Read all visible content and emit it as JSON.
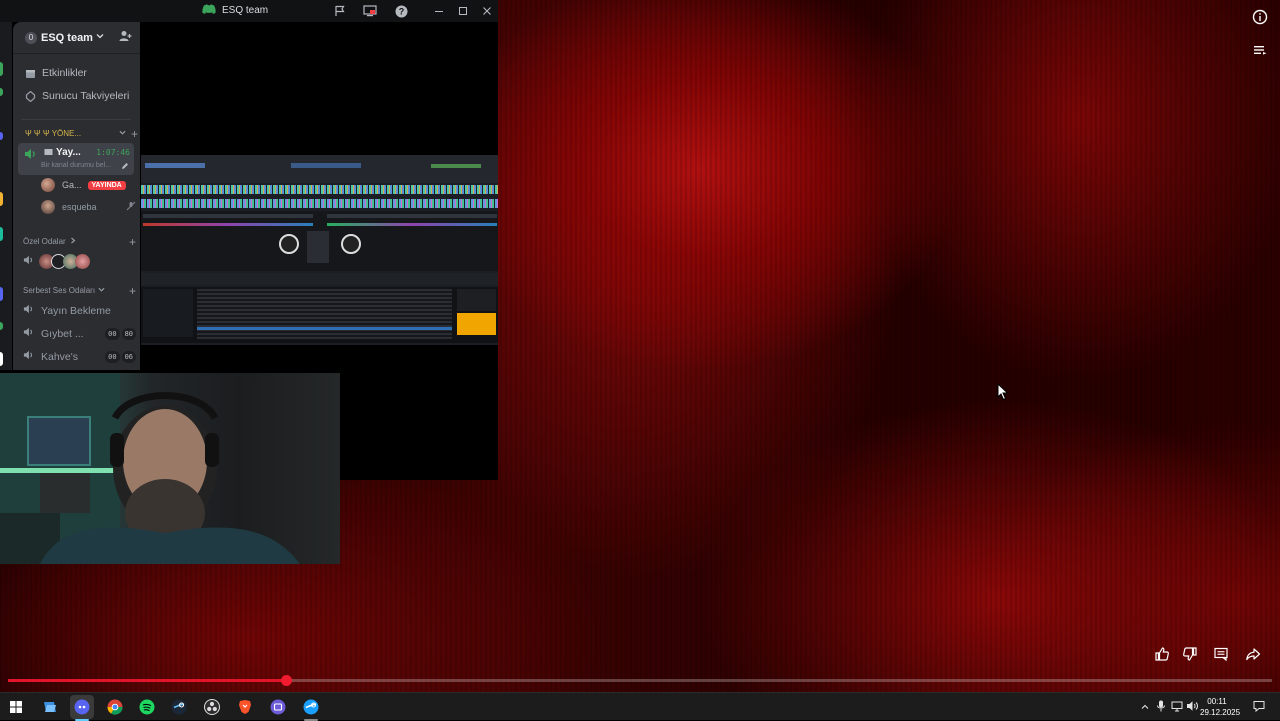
{
  "video": {
    "progress_fraction": 0.22,
    "controls": {
      "info": "info-icon",
      "queue": "queue-icon",
      "like": "thumbs-up-icon",
      "dislike": "thumbs-down-icon",
      "comments": "comments-icon",
      "share": "share-icon"
    },
    "accent_color": "#e0152a"
  },
  "discord": {
    "window_title": "ESQ team",
    "server": {
      "unread_badge": "0",
      "name": "ESQ team"
    },
    "menu": [
      {
        "label": "Etkinlikler",
        "icon": "calendar-icon"
      },
      {
        "label": "Sunucu Takviyeleri",
        "icon": "boost-icon"
      }
    ],
    "category_admin": "Ψ Ψ Ψ YÖNE...",
    "active_channel": {
      "name": "Yay...",
      "timer": "1:07:46",
      "status": "Bir kanal durumu bel..."
    },
    "voice_users": [
      {
        "name": "Ga...",
        "live_label": "YAYINDA"
      },
      {
        "name": "esqueba"
      }
    ],
    "private_rooms_label": "Özel Odalar",
    "free_voice_label": "Serbest Ses Odaları",
    "voice_channels": [
      {
        "name": "Yayın Bekleme"
      },
      {
        "name": "Gıybet ...",
        "count_a": "00",
        "count_b": "80"
      },
      {
        "name": "Kahve's",
        "count_a": "00",
        "count_b": "06"
      }
    ]
  },
  "taskbar": {
    "apps": [
      "windows-start-icon",
      "file-explorer-icon",
      "discord-icon",
      "chrome-icon",
      "spotify-icon",
      "steam-icon",
      "obs-icon",
      "brave-icon",
      "app-icon",
      "steam-alt-icon"
    ],
    "time": "00:11",
    "date": "29.12.2025"
  }
}
